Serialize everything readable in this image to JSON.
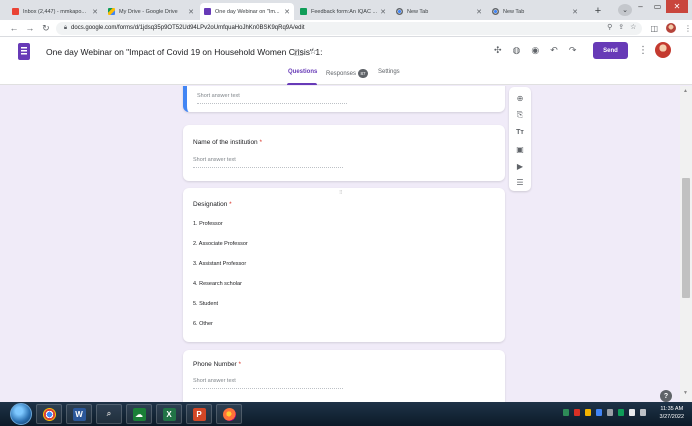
{
  "browser": {
    "tabs": [
      {
        "title": "Inbox (2,447) - mmkapo...",
        "favicon_color": "#ea4335",
        "active": false
      },
      {
        "title": "My Drive - Google Drive",
        "favicon_color": "#fbbc04",
        "active": false
      },
      {
        "title": "One day Webinar on \"Im...",
        "favicon_color": "#673ab7",
        "active": true
      },
      {
        "title": "Feedback form:An IQAC ...",
        "favicon_color": "#0f9d58",
        "active": false
      },
      {
        "title": "New Tab",
        "favicon_color": "#5f6368",
        "active": false
      },
      {
        "title": "New Tab",
        "favicon_color": "#5f6368",
        "active": false
      }
    ],
    "new_tab_glyph": "+",
    "url": "docs.google.com/forms/d/1jdsq35p9OT52Ud94LPv2oUmfquaHoJhKn0BSK9qRq9A/edit"
  },
  "header": {
    "form_title": "One day Webinar on \"Impact of Covid 19 on Household Women Crisis\" 1:",
    "send_label": "Send",
    "tabs": [
      {
        "label": "Questions",
        "active": true
      },
      {
        "label": "Responses",
        "badge": "87",
        "active": false
      },
      {
        "label": "Settings",
        "active": false
      }
    ]
  },
  "questions": [
    {
      "id": "q-prev",
      "title": "",
      "type": "short",
      "placeholder": "Short answer text"
    },
    {
      "id": "q-institution",
      "title": "Name of the institution",
      "required": true,
      "type": "short",
      "placeholder": "Short answer text"
    },
    {
      "id": "q-designation",
      "title": "Designation",
      "required": true,
      "type": "choice",
      "options": [
        "1. Professor",
        "2. Associate Professor",
        "3. Assistant Professor",
        "4. Research scholar",
        "5. Student",
        "6. Other"
      ]
    },
    {
      "id": "q-phone",
      "title": "Phone Number",
      "required": true,
      "type": "short",
      "placeholder": "Short answer text"
    }
  ],
  "required_marker": "*",
  "drag_handle_glyph": "⠿",
  "toolbar_icons": [
    "add-question-icon",
    "import-questions-icon",
    "title-text-icon",
    "image-icon",
    "video-icon",
    "section-icon"
  ],
  "help_glyph": "?",
  "taskbar": {
    "clock_time": "11:35 AM",
    "clock_date": "3/27/2022"
  },
  "colors": {
    "accent": "#673ab7",
    "background": "#f0ebf8",
    "focus": "#4285f4",
    "required": "#d93025"
  }
}
